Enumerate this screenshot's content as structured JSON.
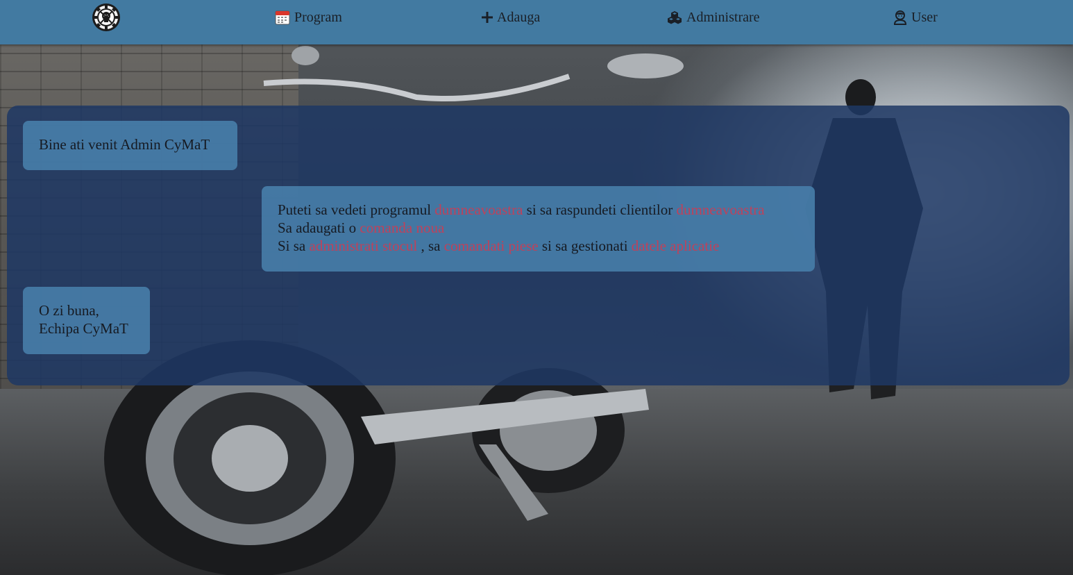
{
  "colors": {
    "navbar": "#427aa1",
    "panel": "#1e3864",
    "bubble": "#467da8",
    "highlight": "#c0415a"
  },
  "navbar": {
    "logo_icon": "gear-skull-logo-icon",
    "items": [
      {
        "label": "Program",
        "icon": "calendar-icon"
      },
      {
        "label": "Adauga",
        "icon": "plus-icon"
      },
      {
        "label": "Administrare",
        "icon": "cubes-icon"
      },
      {
        "label": "User",
        "icon": "user-icon"
      }
    ]
  },
  "messages": {
    "welcome": "Bine ati venit Admin CyMaT",
    "info": {
      "line1": {
        "a": "Puteti sa vedeti programul ",
        "b": "dumneavoastra",
        "c": " si sa raspundeti clientilor ",
        "d": "dumneavoastra"
      },
      "line2": {
        "a": "Sa adaugati o ",
        "b": "comanda noua"
      },
      "line3": {
        "a": "Si sa ",
        "b": "administrati stocul",
        "c": " , sa ",
        "d": "comandati piese",
        "e": " si sa gestionati ",
        "f": "datele aplicatie"
      }
    },
    "closing": {
      "line1": "O zi buna,",
      "line2": "Echipa CyMaT"
    }
  }
}
